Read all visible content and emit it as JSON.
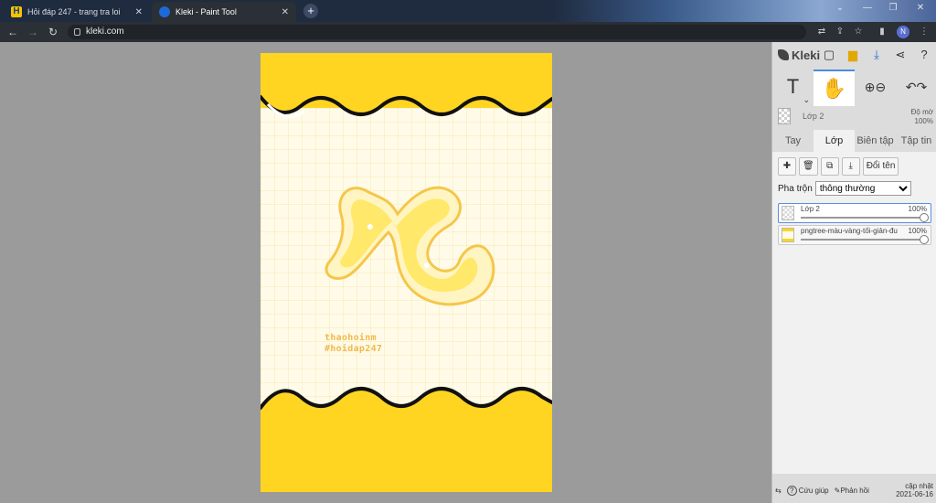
{
  "browser": {
    "tabs": [
      {
        "label": "Hỏi đáp 247 - trang tra loi",
        "active": false
      },
      {
        "label": "Kleki - Paint Tool",
        "active": true
      }
    ],
    "new_tab": "+",
    "url": "kleki.com",
    "profile_initial": "N"
  },
  "artwork": {
    "watermark_line1": "thaohoinm",
    "watermark_line2": "#hoidap247",
    "colors": {
      "yellow": "#ffd521",
      "paper": "#fffbe8",
      "grid": "#f7e7a8",
      "ink": "#111111",
      "letter": "#ffe86a"
    }
  },
  "panel": {
    "logo": "Kleki",
    "layer_name": "Lớp 2",
    "opacity_label": "Độ mờ",
    "opacity_value": "100%",
    "tabs": [
      "Tay",
      "Lớp",
      "Biên tập",
      "Tập tin"
    ],
    "rename_label": "Đổi tên",
    "blend_label": "Pha trộn",
    "blend_value": "thông thường",
    "layers": [
      {
        "name": "Lớp 2",
        "opacity": "100%"
      },
      {
        "name": "pngtree-màu-vàng-tối-giản-đu",
        "opacity": "100%"
      }
    ],
    "footer": {
      "help": "Cứu giúp",
      "feedback": "Phản hồi",
      "update_label": "cập nhật",
      "update_date": "2021-06-16"
    }
  }
}
